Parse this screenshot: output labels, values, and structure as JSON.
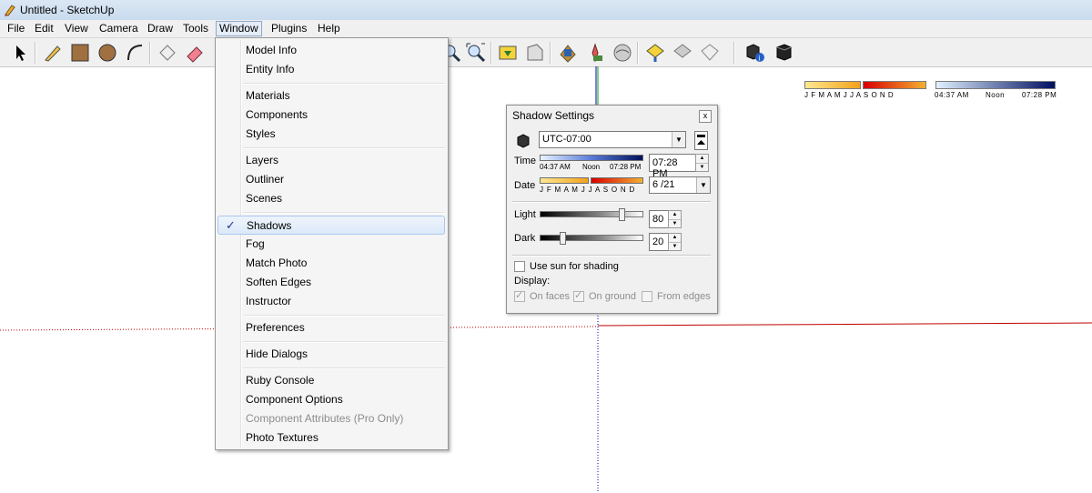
{
  "window": {
    "title": "Untitled - SketchUp"
  },
  "menubar": {
    "items": [
      "File",
      "Edit",
      "View",
      "Camera",
      "Draw",
      "Tools",
      "Window",
      "Plugins",
      "Help"
    ],
    "active": "Window"
  },
  "toolbar": {
    "shadow_strip": {
      "months_label": "J F M A M J J A S O N D",
      "time_start": "04:37 AM",
      "time_noon": "Noon",
      "time_end": "07:28 PM"
    }
  },
  "window_menu": {
    "items": [
      {
        "label": "Model Info"
      },
      {
        "label": "Entity Info"
      },
      {
        "label": "Materials"
      },
      {
        "label": "Components"
      },
      {
        "label": "Styles"
      },
      {
        "label": "Layers"
      },
      {
        "label": "Outliner"
      },
      {
        "label": "Scenes"
      },
      {
        "label": "Shadows",
        "checked": true,
        "highlighted": true
      },
      {
        "label": "Fog"
      },
      {
        "label": "Match Photo"
      },
      {
        "label": "Soften Edges"
      },
      {
        "label": "Instructor"
      },
      {
        "label": "Preferences"
      },
      {
        "label": "Hide Dialogs"
      },
      {
        "label": "Ruby Console"
      },
      {
        "label": "Component Options"
      },
      {
        "label": "Component Attributes (Pro Only)",
        "disabled": true
      },
      {
        "label": "Photo Textures"
      }
    ],
    "check_glyph": "✓"
  },
  "shadow_settings": {
    "title": "Shadow Settings",
    "close_glyph": "x",
    "timezone": "UTC-07:00",
    "time_label": "Time",
    "time_start": "04:37 AM",
    "time_noon": "Noon",
    "time_end": "07:28 PM",
    "time_value": "07:28 PM",
    "date_label": "Date",
    "months_label": "J F M A M J J A S O N D",
    "date_value": "6 /21",
    "light_label": "Light",
    "light_value": "80",
    "dark_label": "Dark",
    "dark_value": "20",
    "use_sun_label": "Use sun for shading",
    "use_sun_checked": false,
    "display_label": "Display:",
    "on_faces_label": "On faces",
    "on_faces_checked": true,
    "on_ground_label": "On ground",
    "on_ground_checked": true,
    "from_edges_label": "From edges",
    "from_edges_checked": false
  },
  "colors": {
    "accent": "#3399ff",
    "red_axis": "#c00000",
    "green_axis": "#00a000",
    "blue_axis": "#0000c0"
  }
}
